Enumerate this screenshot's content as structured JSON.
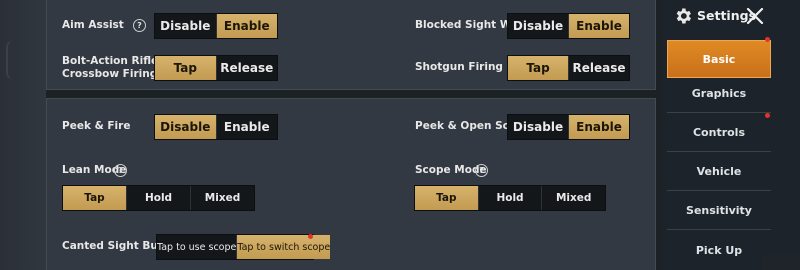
{
  "settings": [
    {
      "label": "Aim Assist",
      "options": [
        "Disable",
        "Enable"
      ],
      "selected": "Enable",
      "help": "?"
    },
    {
      "label": "Blocked Sight Warning",
      "options": [
        "Disable",
        "Enable"
      ],
      "selected": "Enable"
    },
    {
      "label": "Bolt-Action Rifle &",
      "label2": "Crossbow Firing Mode",
      "options": [
        "Tap",
        "Release"
      ],
      "selected": "Tap"
    },
    {
      "label": "Shotgun Firing Mode",
      "options": [
        "Tap",
        "Release"
      ],
      "selected": "Tap"
    },
    {
      "label": "Peek & Fire",
      "options": [
        "Disable",
        "Enable"
      ],
      "selected": "Disable"
    },
    {
      "label": "Peek & Open Scope",
      "options": [
        "Disable",
        "Enable"
      ],
      "selected": "Enable"
    },
    {
      "label": "Lean Mode",
      "options": [
        "Tap",
        "Hold",
        "Mixed"
      ],
      "selected": "Tap",
      "help": "?"
    },
    {
      "label": "Scope Mode",
      "options": [
        "Tap",
        "Hold",
        "Mixed"
      ],
      "selected": "Tap",
      "help": "?"
    },
    {
      "label": "Canted Sight Button",
      "options": [
        "Tap to use scope",
        "Tap to switch scope"
      ],
      "selected": "Tap to switch scope"
    }
  ],
  "sidebar": {
    "title": "Settings",
    "items": [
      {
        "label": "Basic",
        "active": true,
        "badge": true
      },
      {
        "label": "Graphics",
        "active": false,
        "badge": false
      },
      {
        "label": "Controls",
        "active": false,
        "badge": true
      },
      {
        "label": "Vehicle",
        "active": false,
        "badge": false
      },
      {
        "label": "Sensitivity",
        "active": false,
        "badge": false
      },
      {
        "label": "Pick Up",
        "active": false,
        "badge": false
      }
    ]
  },
  "colors": {
    "selected_gold": "#d6b26b",
    "active_tab_orange": "#e08a25",
    "badge_red": "#e0342c"
  },
  "icons": [
    "gear-icon",
    "close-icon",
    "help-icon"
  ]
}
